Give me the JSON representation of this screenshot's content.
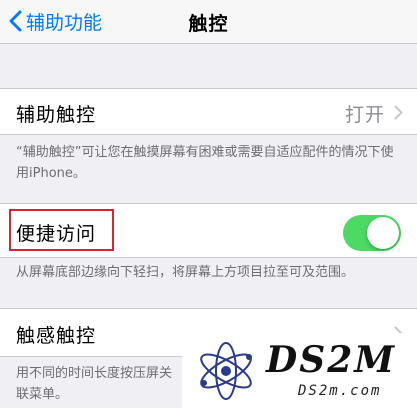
{
  "nav": {
    "back_label": "辅助功能",
    "title": "触控"
  },
  "assistive_touch": {
    "label": "辅助触控",
    "value": "打开",
    "footer": "“辅助触控”可让您在触摸屏幕有困难或需要自适应配件的情况下使用iPhone。"
  },
  "reachability": {
    "label": "便捷访问",
    "enabled": true,
    "footer": "从屏幕底部边缘向下轻扫，将屏幕上方项目拉至可及范围。"
  },
  "haptic_touch": {
    "label": "触感触控",
    "footer": "用不同的时间长度按压屏关联菜单。"
  },
  "watermark": {
    "logo_text": "DS2M",
    "url": "DS2m.com"
  },
  "colors": {
    "accent": "#007aff",
    "switch_on": "#4cd964",
    "highlight": "#d9232e"
  }
}
